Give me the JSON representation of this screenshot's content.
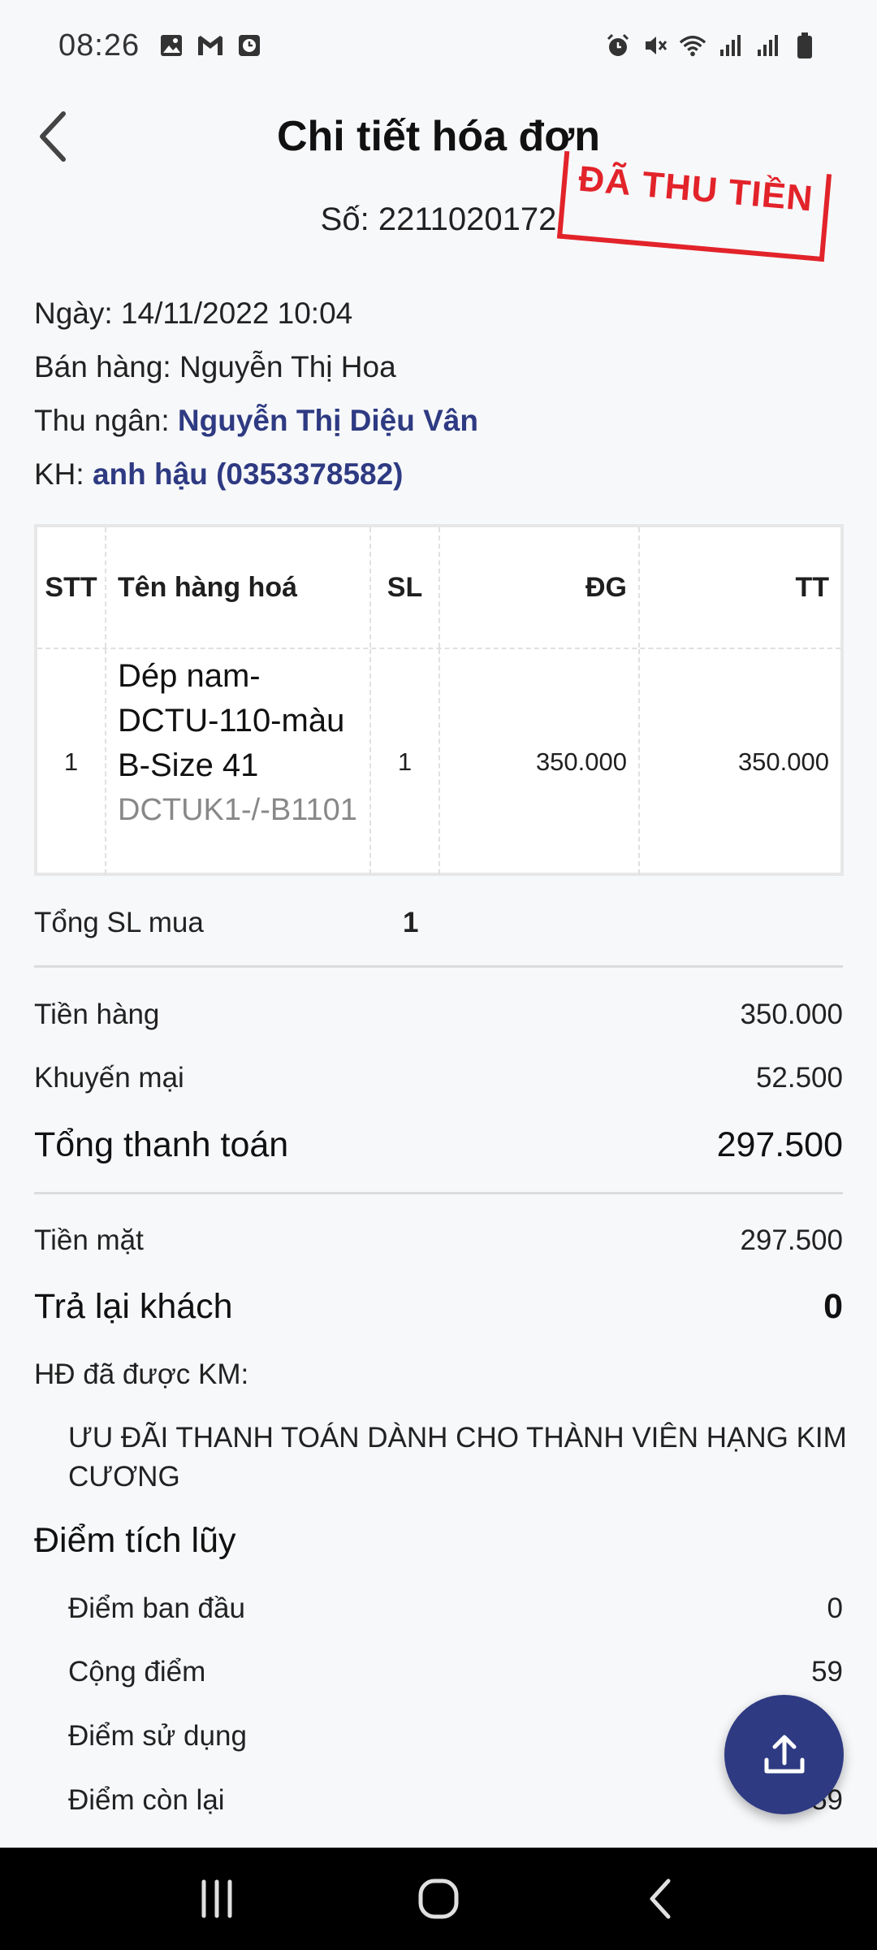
{
  "status_bar": {
    "time": "08:26",
    "left_icons": [
      "image-icon",
      "gmail-icon",
      "clock-app-icon"
    ],
    "right_icons": [
      "alarm-icon",
      "mute-icon",
      "wifi-icon",
      "signal-icon",
      "signal-icon",
      "battery-icon"
    ]
  },
  "header": {
    "title": "Chi tiết hóa đơn",
    "back_icon": "chevron-left-icon"
  },
  "invoice": {
    "number": "Số: 2211020172",
    "stamp": "ĐÃ THU TIỀN",
    "date": "Ngày: 14/11/2022 10:04",
    "seller_label": "Bán hàng: ",
    "seller": "Nguyễn Thị Hoa",
    "cashier_label": "Thu ngân: ",
    "cashier": "Nguyễn Thị Diệu Vân",
    "customer_label": "KH: ",
    "customer": "anh hậu (0353378582)"
  },
  "table": {
    "headers": [
      "STT",
      "Tên hàng hoá",
      "SL",
      "ĐG",
      "TT"
    ],
    "rows": [
      {
        "stt": "1",
        "name": "Dép nam-DCTU-110-màu B-Size 41",
        "code": "DCTUK1-/-B1101",
        "qty": "1",
        "price": "350.000",
        "total": "350.000"
      }
    ]
  },
  "summary": {
    "total_qty_label": "Tổng SL mua",
    "total_qty": "1",
    "goods_label": "Tiền hàng",
    "goods": "350.000",
    "discount_label": "Khuyến mại",
    "discount": "52.500",
    "grand_total_label": "Tổng thanh toán",
    "grand_total": "297.500",
    "cash_label": "Tiền mặt",
    "cash": "297.500",
    "change_label": "Trả lại khách",
    "change": "0"
  },
  "promotion": {
    "label": "HĐ đã được KM:",
    "text": "ƯU ĐÃI THANH TOÁN DÀNH CHO THÀNH VIÊN HẠNG KIM CƯƠNG"
  },
  "points": {
    "title": "Điểm tích lũy",
    "initial_label": "Điểm ban đầu",
    "initial": "0",
    "added_label": "Cộng điểm",
    "added": "59",
    "used_label": "Điểm sử dụng",
    "used": "",
    "remaining_label": "Điểm còn lại",
    "remaining": "59"
  },
  "fab": {
    "icon": "share-upload-icon"
  },
  "nav": {
    "icons": [
      "recent-apps-icon",
      "home-icon",
      "back-icon"
    ]
  },
  "colors": {
    "accent": "#2e3a82",
    "stamp": "#e2232a",
    "nav": "#000000"
  }
}
